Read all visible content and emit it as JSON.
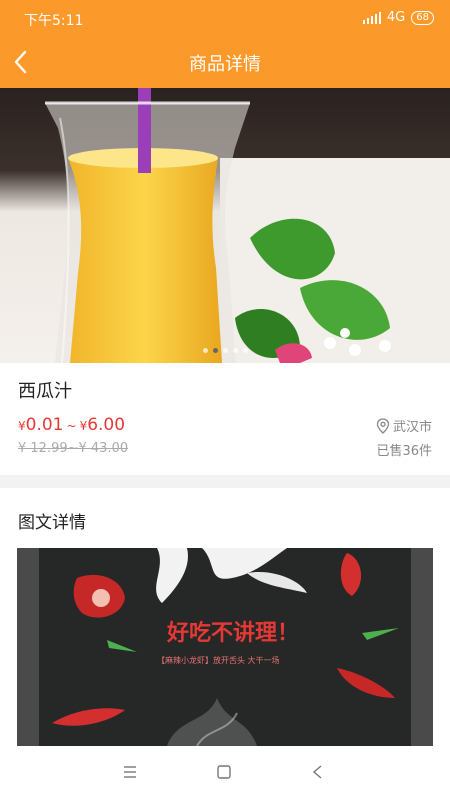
{
  "status_bar": {
    "time": "下午5:11",
    "network": "4G",
    "battery": "68"
  },
  "nav": {
    "title": "商品详情"
  },
  "product": {
    "name": "西瓜汁",
    "currency": "¥",
    "price_min": "0.01",
    "price_sep": "~",
    "price_max": "6.00",
    "original_price": "¥ 12.99~¥ 43.00",
    "location": "武汉市",
    "sold": "已售36件",
    "carousel_count": 5,
    "carousel_active": 2
  },
  "detail": {
    "title": "图文详情",
    "poster": {
      "headline": "好吃不讲理！",
      "subline": "【麻辣小龙虾】放开舌头 大干一场"
    }
  },
  "colors": {
    "accent": "#fb9a2a",
    "price": "#e53935"
  },
  "icons": {
    "back": "chevron-left-icon",
    "location": "map-pin-icon",
    "menu": "menu-icon",
    "home": "home-square-icon",
    "android_back": "back-triangle-icon"
  }
}
